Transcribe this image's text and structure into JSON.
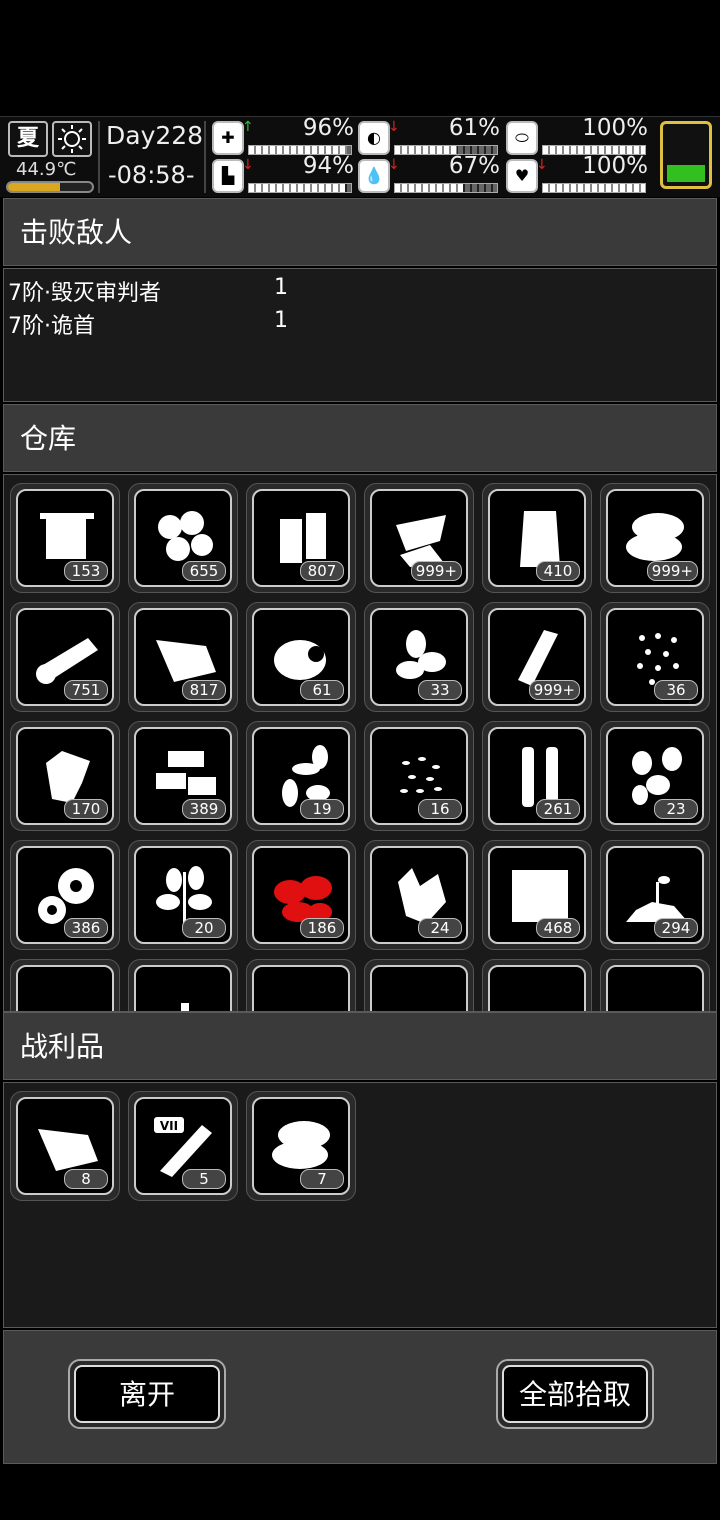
{
  "status": {
    "season": "夏",
    "weather_icon": "sun-icon",
    "temperature": "44.9℃",
    "temperature_level": 0.62,
    "day": "Day228",
    "clock": "-08:58-",
    "stats": [
      {
        "icon": "medkit-icon",
        "arrow": "↑",
        "arrow_color": "#30c030",
        "value": "96%",
        "level": 0.96
      },
      {
        "icon": "stomach-icon",
        "arrow": "↓",
        "arrow_color": "#e02020",
        "value": "61%",
        "level": 0.61
      },
      {
        "icon": "pill-icon",
        "arrow": "",
        "arrow_color": "#e02020",
        "value": "100%",
        "level": 1.0
      },
      {
        "icon": "boot-icon",
        "arrow": "↓",
        "arrow_color": "#e02020",
        "value": "94%",
        "level": 0.94
      },
      {
        "icon": "water-drop-icon",
        "arrow": "↓",
        "arrow_color": "#e02020",
        "value": "67%",
        "level": 0.67
      },
      {
        "icon": "heart-icon",
        "arrow": "↓",
        "arrow_color": "#e02020",
        "value": "100%",
        "level": 1.0
      }
    ],
    "battery_level": 0.3,
    "battery_color": "#32c020"
  },
  "defeated": {
    "title": "击败敌人",
    "enemies": [
      {
        "name": "7阶·毁灭审判者",
        "count": "1"
      },
      {
        "name": "7阶·诡首",
        "count": "1"
      }
    ]
  },
  "warehouse": {
    "title": "仓库",
    "items": [
      {
        "icon": "towel-icon",
        "count": "153"
      },
      {
        "icon": "potatoes-icon",
        "count": "655"
      },
      {
        "icon": "battery-icon",
        "count": "807"
      },
      {
        "icon": "scrap-plate-icon",
        "count": "999+"
      },
      {
        "icon": "flour-sack-icon",
        "count": "410"
      },
      {
        "icon": "cloth-icon",
        "count": "999+"
      },
      {
        "icon": "log-icon",
        "count": "751"
      },
      {
        "icon": "meat-icon",
        "count": "817"
      },
      {
        "icon": "egg-icon",
        "count": "61"
      },
      {
        "icon": "nuts-icon",
        "count": "33"
      },
      {
        "icon": "bottle-icon",
        "count": "999+"
      },
      {
        "icon": "seeds-icon",
        "count": "36"
      },
      {
        "icon": "crystal-icon",
        "count": "170"
      },
      {
        "icon": "bricks-icon",
        "count": "389"
      },
      {
        "icon": "leaf-seeds-icon",
        "count": "19"
      },
      {
        "icon": "rice-icon",
        "count": "16"
      },
      {
        "icon": "cartridges-icon",
        "count": "261"
      },
      {
        "icon": "beans-icon",
        "count": "23"
      },
      {
        "icon": "gears-icon",
        "count": "386"
      },
      {
        "icon": "herb-branch-icon",
        "count": "20"
      },
      {
        "icon": "red-herb-icon",
        "count": "186"
      },
      {
        "icon": "ginger-icon",
        "count": "24"
      },
      {
        "icon": "cloth-bolt-icon",
        "count": "468"
      },
      {
        "icon": "soil-sprout-icon",
        "count": "294"
      },
      {
        "icon": "paper-icon",
        "count": ""
      },
      {
        "icon": "small-bottle-icon",
        "count": ""
      },
      {
        "icon": "yellow-herb-icon",
        "count": ""
      },
      {
        "icon": "white-leaf-icon",
        "count": ""
      },
      {
        "icon": "mushrooms-icon",
        "count": ""
      },
      {
        "icon": "red-leaf-icon",
        "count": ""
      }
    ]
  },
  "loot": {
    "title": "战利品",
    "items": [
      {
        "icon": "meat-icon",
        "count": "8"
      },
      {
        "icon": "vii-test-tube-icon",
        "count": "5",
        "badge": "VII"
      },
      {
        "icon": "cloth-icon",
        "count": "7"
      }
    ]
  },
  "buttons": {
    "leave": "离开",
    "take_all": "全部拾取"
  }
}
